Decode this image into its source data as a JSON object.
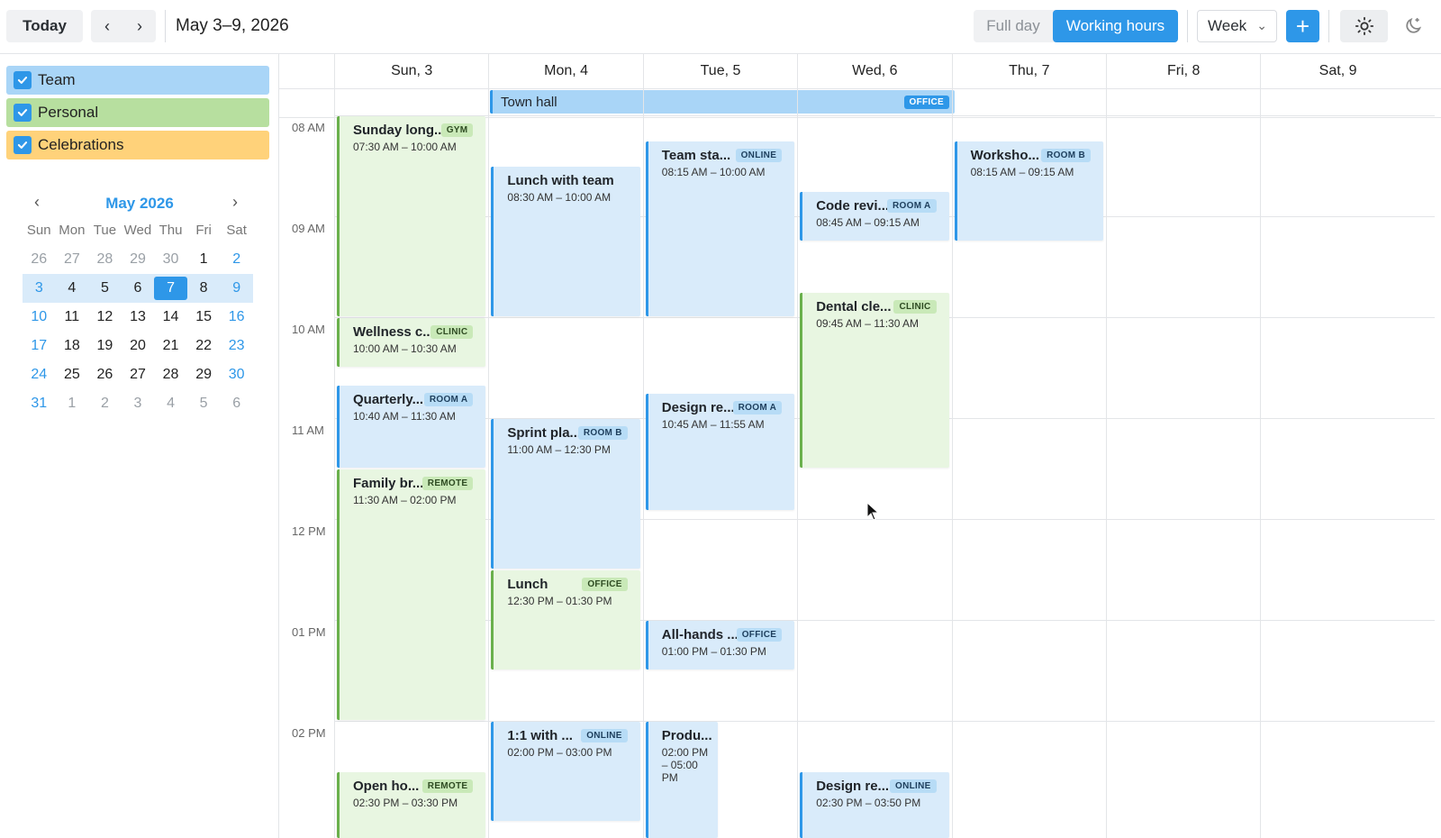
{
  "toolbar": {
    "today": "Today",
    "range": "May 3–9, 2026",
    "full_day": "Full day",
    "working_hours": "Working hours",
    "view": "Week"
  },
  "calendars": [
    {
      "label": "Team",
      "color": "#a9d5f7"
    },
    {
      "label": "Personal",
      "color": "#b7df9f"
    },
    {
      "label": "Celebrations",
      "color": "#ffd27a"
    }
  ],
  "mini": {
    "title": "May 2026",
    "dow": [
      "Sun",
      "Mon",
      "Tue",
      "Wed",
      "Thu",
      "Fri",
      "Sat"
    ],
    "weeks": [
      [
        "26",
        "27",
        "28",
        "29",
        "30",
        "1",
        "2"
      ],
      [
        "3",
        "4",
        "5",
        "6",
        "7",
        "8",
        "9"
      ],
      [
        "10",
        "11",
        "12",
        "13",
        "14",
        "15",
        "16"
      ],
      [
        "17",
        "18",
        "19",
        "20",
        "21",
        "22",
        "23"
      ],
      [
        "24",
        "25",
        "26",
        "27",
        "28",
        "29",
        "30"
      ],
      [
        "31",
        "1",
        "2",
        "3",
        "4",
        "5",
        "6"
      ]
    ]
  },
  "days": [
    "Sun, 3",
    "Mon, 4",
    "Tue, 5",
    "Wed, 6",
    "Thu, 7",
    "Fri, 8",
    "Sat, 9"
  ],
  "hours": [
    "08 AM",
    "09 AM",
    "10 AM",
    "11 AM",
    "12 PM",
    "01 PM",
    "02 PM"
  ],
  "allday": {
    "title": "Town hall",
    "tag": "OFFICE"
  },
  "events": [
    {
      "title": "Sunday long...",
      "time": "07:30 AM – 10:00 AM",
      "tag": "GYM",
      "color": "green"
    },
    {
      "title": "Wellness c...",
      "time": "10:00 AM – 10:30 AM",
      "tag": "CLINIC",
      "color": "green"
    },
    {
      "title": "Quarterly...",
      "time": "10:40 AM – 11:30 AM",
      "tag": "ROOM A",
      "color": "blue"
    },
    {
      "title": "Family br...",
      "time": "11:30 AM – 02:00 PM",
      "tag": "REMOTE",
      "color": "green"
    },
    {
      "title": "Open ho...",
      "time": "02:30 PM – 03:30 PM",
      "tag": "REMOTE",
      "color": "green"
    },
    {
      "title": "Lunch with team",
      "time": "08:30 AM – 10:00 AM",
      "tag": "",
      "color": "blue"
    },
    {
      "title": "Sprint pla...",
      "time": "11:00 AM – 12:30 PM",
      "tag": "ROOM B",
      "color": "blue"
    },
    {
      "title": "Lunch",
      "time": "12:30 PM – 01:30 PM",
      "tag": "OFFICE",
      "color": "green"
    },
    {
      "title": "1:1 with ...",
      "time": "02:00 PM – 03:00 PM",
      "tag": "ONLINE",
      "color": "blue"
    },
    {
      "title": "Team sta...",
      "time": "08:15 AM – 10:00 AM",
      "tag": "ONLINE",
      "color": "blue"
    },
    {
      "title": "Design re...",
      "time": "10:45 AM – 11:55 AM",
      "tag": "ROOM A",
      "color": "blue"
    },
    {
      "title": "All-hands ...",
      "time": "01:00 PM – 01:30 PM",
      "tag": "OFFICE",
      "color": "blue"
    },
    {
      "title": "Produ...",
      "time": "02:00 PM – 05:00 PM",
      "tag": "",
      "color": "blue"
    },
    {
      "title": "Code revi...",
      "time": "08:45 AM – 09:15 AM",
      "tag": "ROOM A",
      "color": "blue"
    },
    {
      "title": "Dental cle...",
      "time": "09:45 AM – 11:30 AM",
      "tag": "CLINIC",
      "color": "green"
    },
    {
      "title": "Design re...",
      "time": "02:30 PM – 03:50 PM",
      "tag": "ONLINE",
      "color": "blue"
    },
    {
      "title": "Worksho...",
      "time": "08:15 AM – 09:15 AM",
      "tag": "ROOM B",
      "color": "blue"
    }
  ]
}
